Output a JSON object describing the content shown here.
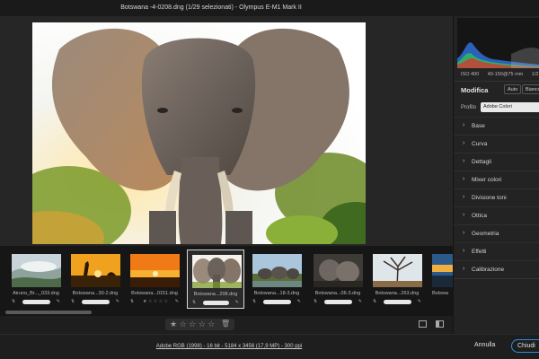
{
  "window": {
    "title": "Botswana -4-0208.dng (1/29 selezionati)  -  Olympus E-M1 Mark II"
  },
  "filmstrip": {
    "thumbnails": [
      {
        "name": "Airuno_Br..._033.dng",
        "selected": false,
        "theme": "mist"
      },
      {
        "name": "Botswana...30-2.dng",
        "selected": false,
        "theme": "sunset-giraffe"
      },
      {
        "name": "Botswana...0151.dng",
        "selected": false,
        "theme": "sunset"
      },
      {
        "name": "Botswana...208.dng",
        "selected": true,
        "theme": "elephant"
      },
      {
        "name": "Botswana...18-3.dng",
        "selected": false,
        "theme": "herd"
      },
      {
        "name": "Botswana...06-3.dng",
        "selected": false,
        "theme": "elephants-dark"
      },
      {
        "name": "Botswana...263.dng",
        "selected": false,
        "theme": "tree"
      },
      {
        "name": "Botswa",
        "selected": false,
        "theme": "blue"
      }
    ]
  },
  "rating": {
    "stars": "★ ☆ ☆ ☆ ☆",
    "value": 1,
    "max": 5,
    "delete_icon": "trash-icon"
  },
  "status": {
    "info": "Adobe RGB (1998) - 16 bit - 5184 x 3456 (17,9 MP) - 300 ppi"
  },
  "actions": {
    "cancel": "Annulla",
    "close": "Chiudi"
  },
  "panel": {
    "camera": {
      "iso": "ISO 400",
      "lens": "40-150@75 mm",
      "shutter": "1/2"
    },
    "edit_title": "Modifica",
    "auto_label": "Auto",
    "bw_label": "Bianco",
    "profile_label": "Profilo",
    "profile_value": "Adobe Colori",
    "sections": [
      "Base",
      "Curva",
      "Dettagli",
      "Mixer colori",
      "Divisione toni",
      "Ottica",
      "Geometria",
      "Effetti",
      "Calibrazione"
    ]
  }
}
